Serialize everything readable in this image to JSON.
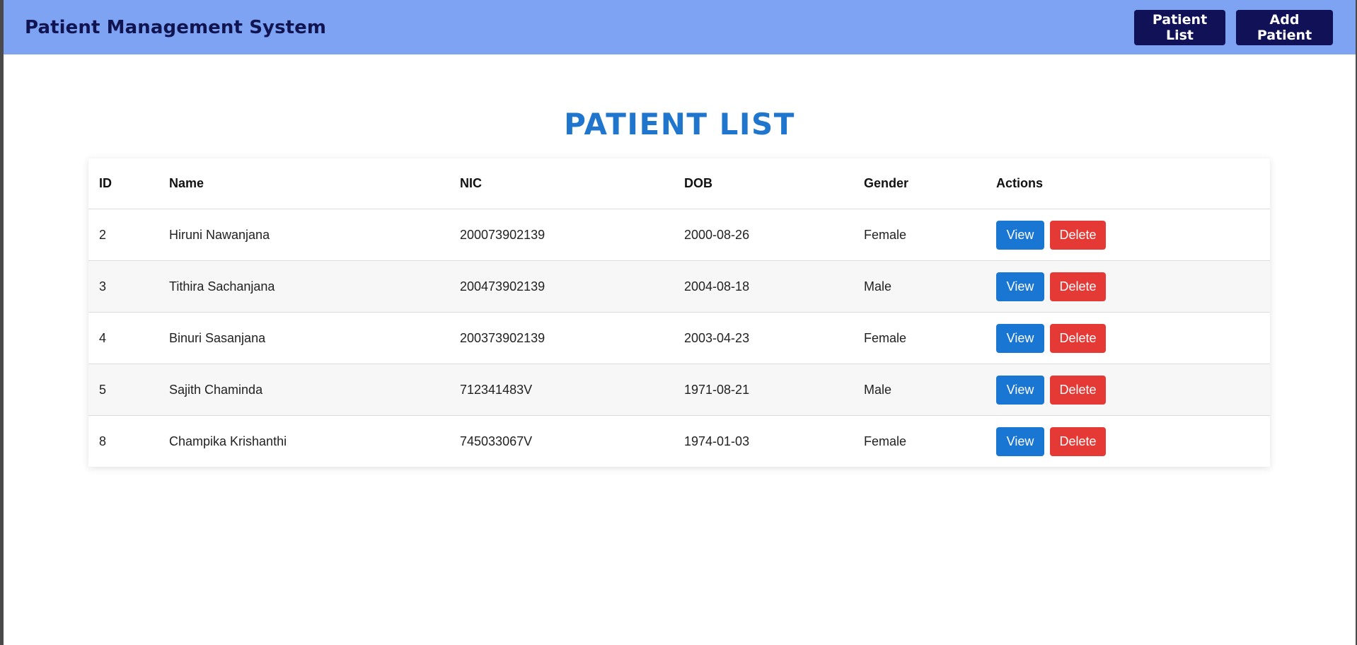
{
  "header": {
    "title": "Patient Management System",
    "nav": {
      "patient_list_label": "Patient List",
      "add_patient_label": "Add Patient"
    }
  },
  "main": {
    "page_title": "PATIENT LIST",
    "table": {
      "columns": [
        "ID",
        "Name",
        "NIC",
        "DOB",
        "Gender",
        "Actions"
      ],
      "rows": [
        {
          "id": "2",
          "name": "Hiruni Nawanjana",
          "nic": "200073902139",
          "dob": "2000-08-26",
          "gender": "Female"
        },
        {
          "id": "3",
          "name": "Tithira Sachanjana",
          "nic": "200473902139",
          "dob": "2004-08-18",
          "gender": "Male"
        },
        {
          "id": "4",
          "name": "Binuri Sasanjana",
          "nic": "200373902139",
          "dob": "2003-04-23",
          "gender": "Female"
        },
        {
          "id": "5",
          "name": "Sajith Chaminda",
          "nic": "712341483V",
          "dob": "1971-08-21",
          "gender": "Male"
        },
        {
          "id": "8",
          "name": "Champika Krishanthi",
          "nic": "745033067V",
          "dob": "1974-01-03",
          "gender": "Female"
        }
      ],
      "actions": {
        "view_label": "View",
        "delete_label": "Delete"
      }
    }
  },
  "colors": {
    "navbar_bg": "#7fa3f3",
    "nav_button_bg": "#111158",
    "title_color": "#1f76cc",
    "view_button": "#1976d2",
    "delete_button": "#e53935"
  }
}
